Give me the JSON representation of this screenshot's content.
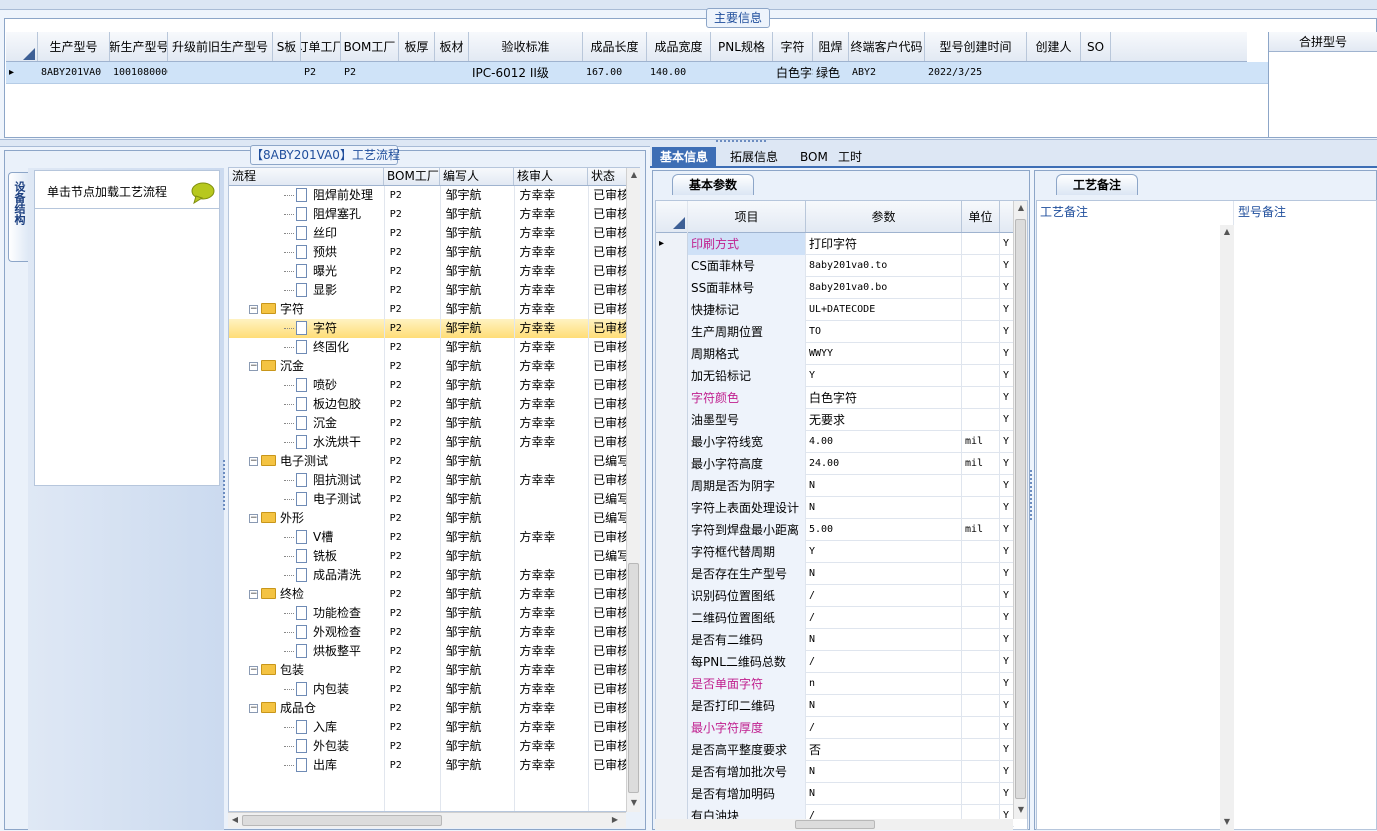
{
  "main_info": {
    "title": "主要信息",
    "columns": [
      "生产型号",
      "新生产型号",
      "升级前旧生产型号",
      "S板",
      "订单工厂",
      "BOM工厂",
      "板厚",
      "板材",
      "验收标准",
      "成品长度",
      "成品宽度",
      "PNL规格",
      "字符",
      "阻焊",
      "终端客户代码",
      "型号创建时间",
      "创建人",
      "SO"
    ],
    "row": [
      "8ABY201VA0",
      "10010800066010",
      "",
      "",
      "P2",
      "P2",
      "",
      "",
      "IPC-6012 II级",
      "167.00",
      "140.00",
      "",
      "白色字符",
      "绿色",
      "ABY2",
      "2022/3/25",
      "",
      ""
    ],
    "merge_column": "合拼型号"
  },
  "flow_panel": {
    "title": "【8ABY201VA0】工艺流程",
    "vertical_tab": "设备结构",
    "nav_hint": "单击节点加载工艺流程",
    "columns": [
      "流程",
      "BOM工厂",
      "编写人",
      "核审人",
      "状态"
    ],
    "rows": [
      {
        "level": 2,
        "type": "doc",
        "name": "阻焊前处理",
        "bom": "P2",
        "writer": "邹宇航",
        "reviewer": "方幸幸",
        "status": "已审核"
      },
      {
        "level": 2,
        "type": "doc",
        "name": "阻焊塞孔",
        "bom": "P2",
        "writer": "邹宇航",
        "reviewer": "方幸幸",
        "status": "已审核"
      },
      {
        "level": 2,
        "type": "doc",
        "name": "丝印",
        "bom": "P2",
        "writer": "邹宇航",
        "reviewer": "方幸幸",
        "status": "已审核"
      },
      {
        "level": 2,
        "type": "doc",
        "name": "预烘",
        "bom": "P2",
        "writer": "邹宇航",
        "reviewer": "方幸幸",
        "status": "已审核"
      },
      {
        "level": 2,
        "type": "doc",
        "name": "曝光",
        "bom": "P2",
        "writer": "邹宇航",
        "reviewer": "方幸幸",
        "status": "已审核"
      },
      {
        "level": 2,
        "type": "doc",
        "name": "显影",
        "bom": "P2",
        "writer": "邹宇航",
        "reviewer": "方幸幸",
        "status": "已审核"
      },
      {
        "level": 1,
        "type": "folder",
        "name": "字符",
        "bom": "P2",
        "writer": "邹宇航",
        "reviewer": "方幸幸",
        "status": "已审核"
      },
      {
        "level": 2,
        "type": "doc",
        "name": "字符",
        "bom": "P2",
        "writer": "邹宇航",
        "reviewer": "方幸幸",
        "status": "已审核",
        "selected": true
      },
      {
        "level": 2,
        "type": "doc",
        "name": "终固化",
        "bom": "P2",
        "writer": "邹宇航",
        "reviewer": "方幸幸",
        "status": "已审核"
      },
      {
        "level": 1,
        "type": "folder",
        "name": "沉金",
        "bom": "P2",
        "writer": "邹宇航",
        "reviewer": "方幸幸",
        "status": "已审核"
      },
      {
        "level": 2,
        "type": "doc",
        "name": "喷砂",
        "bom": "P2",
        "writer": "邹宇航",
        "reviewer": "方幸幸",
        "status": "已审核"
      },
      {
        "level": 2,
        "type": "doc",
        "name": "板边包胶",
        "bom": "P2",
        "writer": "邹宇航",
        "reviewer": "方幸幸",
        "status": "已审核"
      },
      {
        "level": 2,
        "type": "doc",
        "name": "沉金",
        "bom": "P2",
        "writer": "邹宇航",
        "reviewer": "方幸幸",
        "status": "已审核"
      },
      {
        "level": 2,
        "type": "doc",
        "name": "水洗烘干",
        "bom": "P2",
        "writer": "邹宇航",
        "reviewer": "方幸幸",
        "status": "已审核"
      },
      {
        "level": 1,
        "type": "folder",
        "name": "电子测试",
        "bom": "P2",
        "writer": "邹宇航",
        "reviewer": "",
        "status": "已编写"
      },
      {
        "level": 2,
        "type": "doc",
        "name": "阻抗测试",
        "bom": "P2",
        "writer": "邹宇航",
        "reviewer": "方幸幸",
        "status": "已审核"
      },
      {
        "level": 2,
        "type": "doc",
        "name": "电子测试",
        "bom": "P2",
        "writer": "邹宇航",
        "reviewer": "",
        "status": "已编写"
      },
      {
        "level": 1,
        "type": "folder",
        "name": "外形",
        "bom": "P2",
        "writer": "邹宇航",
        "reviewer": "",
        "status": "已编写"
      },
      {
        "level": 2,
        "type": "doc",
        "name": "V槽",
        "bom": "P2",
        "writer": "邹宇航",
        "reviewer": "方幸幸",
        "status": "已审核"
      },
      {
        "level": 2,
        "type": "doc",
        "name": "铣板",
        "bom": "P2",
        "writer": "邹宇航",
        "reviewer": "",
        "status": "已编写"
      },
      {
        "level": 2,
        "type": "doc",
        "name": "成品清洗",
        "bom": "P2",
        "writer": "邹宇航",
        "reviewer": "方幸幸",
        "status": "已审核"
      },
      {
        "level": 1,
        "type": "folder",
        "name": "终检",
        "bom": "P2",
        "writer": "邹宇航",
        "reviewer": "方幸幸",
        "status": "已审核"
      },
      {
        "level": 2,
        "type": "doc",
        "name": "功能检查",
        "bom": "P2",
        "writer": "邹宇航",
        "reviewer": "方幸幸",
        "status": "已审核"
      },
      {
        "level": 2,
        "type": "doc",
        "name": "外观检查",
        "bom": "P2",
        "writer": "邹宇航",
        "reviewer": "方幸幸",
        "status": "已审核"
      },
      {
        "level": 2,
        "type": "doc",
        "name": "烘板整平",
        "bom": "P2",
        "writer": "邹宇航",
        "reviewer": "方幸幸",
        "status": "已审核"
      },
      {
        "level": 1,
        "type": "folder",
        "name": "包装",
        "bom": "P2",
        "writer": "邹宇航",
        "reviewer": "方幸幸",
        "status": "已审核"
      },
      {
        "level": 2,
        "type": "doc",
        "name": "内包装",
        "bom": "P2",
        "writer": "邹宇航",
        "reviewer": "方幸幸",
        "status": "已审核"
      },
      {
        "level": 1,
        "type": "folder",
        "name": "成品仓",
        "bom": "P2",
        "writer": "邹宇航",
        "reviewer": "方幸幸",
        "status": "已审核"
      },
      {
        "level": 2,
        "type": "doc",
        "name": "入库",
        "bom": "P2",
        "writer": "邹宇航",
        "reviewer": "方幸幸",
        "status": "已审核"
      },
      {
        "level": 2,
        "type": "doc",
        "name": "外包装",
        "bom": "P2",
        "writer": "邹宇航",
        "reviewer": "方幸幸",
        "status": "已审核"
      },
      {
        "level": 2,
        "type": "doc",
        "name": "出库",
        "bom": "P2",
        "writer": "邹宇航",
        "reviewer": "方幸幸",
        "status": "已审核"
      }
    ]
  },
  "right_tabs": [
    "基本信息",
    "拓展信息",
    "BOM",
    "工时"
  ],
  "basic_params": {
    "tab": "基本参数",
    "columns": [
      "项目",
      "参数",
      "单位"
    ],
    "rows": [
      {
        "item": "印刷方式",
        "param": "打印字符",
        "unit": "",
        "flag": "Y",
        "pink": true,
        "current": true
      },
      {
        "item": "CS面菲林号",
        "param": "8aby201va0.to",
        "unit": "",
        "flag": "Y"
      },
      {
        "item": "SS面菲林号",
        "param": "8aby201va0.bo",
        "unit": "",
        "flag": "Y"
      },
      {
        "item": "快捷标记",
        "param": "UL+DATECODE",
        "unit": "",
        "flag": "Y"
      },
      {
        "item": "生产周期位置",
        "param": "TO",
        "unit": "",
        "flag": "Y"
      },
      {
        "item": "周期格式",
        "param": "WWYY",
        "unit": "",
        "flag": "Y"
      },
      {
        "item": "加无铅标记",
        "param": "Y",
        "unit": "",
        "flag": "Y"
      },
      {
        "item": "字符颜色",
        "param": "白色字符",
        "unit": "",
        "flag": "Y",
        "pink": true
      },
      {
        "item": "油墨型号",
        "param": "无要求",
        "unit": "",
        "flag": "Y"
      },
      {
        "item": "最小字符线宽",
        "param": "4.00",
        "unit": "mil",
        "flag": "Y"
      },
      {
        "item": "最小字符高度",
        "param": "24.00",
        "unit": "mil",
        "flag": "Y"
      },
      {
        "item": "周期是否为阴字",
        "param": "N",
        "unit": "",
        "flag": "Y"
      },
      {
        "item": "字符上表面处理设计",
        "param": "N",
        "unit": "",
        "flag": "Y"
      },
      {
        "item": "字符到焊盘最小距离",
        "param": "5.00",
        "unit": "mil",
        "flag": "Y"
      },
      {
        "item": "字符框代替周期",
        "param": "Y",
        "unit": "",
        "flag": "Y"
      },
      {
        "item": "是否存在生产型号",
        "param": "N",
        "unit": "",
        "flag": "Y"
      },
      {
        "item": "识别码位置图纸",
        "param": "/",
        "unit": "",
        "flag": "Y"
      },
      {
        "item": "二维码位置图纸",
        "param": "/",
        "unit": "",
        "flag": "Y"
      },
      {
        "item": "是否有二维码",
        "param": "N",
        "unit": "",
        "flag": "Y"
      },
      {
        "item": "每PNL二维码总数",
        "param": "/",
        "unit": "",
        "flag": "Y"
      },
      {
        "item": "是否单面字符",
        "param": "n",
        "unit": "",
        "flag": "Y",
        "pink": true
      },
      {
        "item": "是否打印二维码",
        "param": "N",
        "unit": "",
        "flag": "Y"
      },
      {
        "item": "最小字符厚度",
        "param": "/",
        "unit": "",
        "flag": "Y",
        "pink": true
      },
      {
        "item": "是否高平整度要求",
        "param": "否",
        "unit": "",
        "flag": "Y"
      },
      {
        "item": "是否有增加批次号",
        "param": "N",
        "unit": "",
        "flag": "Y"
      },
      {
        "item": "是否有增加明码",
        "param": "N",
        "unit": "",
        "flag": "Y"
      },
      {
        "item": "有白油块",
        "param": "/",
        "unit": "",
        "flag": "Y"
      }
    ]
  },
  "notes": {
    "tab": "工艺备注",
    "col1": "工艺备注",
    "col2": "型号备注"
  },
  "colors": {
    "accent": "#3d6eb5",
    "selected_row": "#ffdd77",
    "pink_label": "#c0208f",
    "header_text": "#1f4e9c"
  }
}
